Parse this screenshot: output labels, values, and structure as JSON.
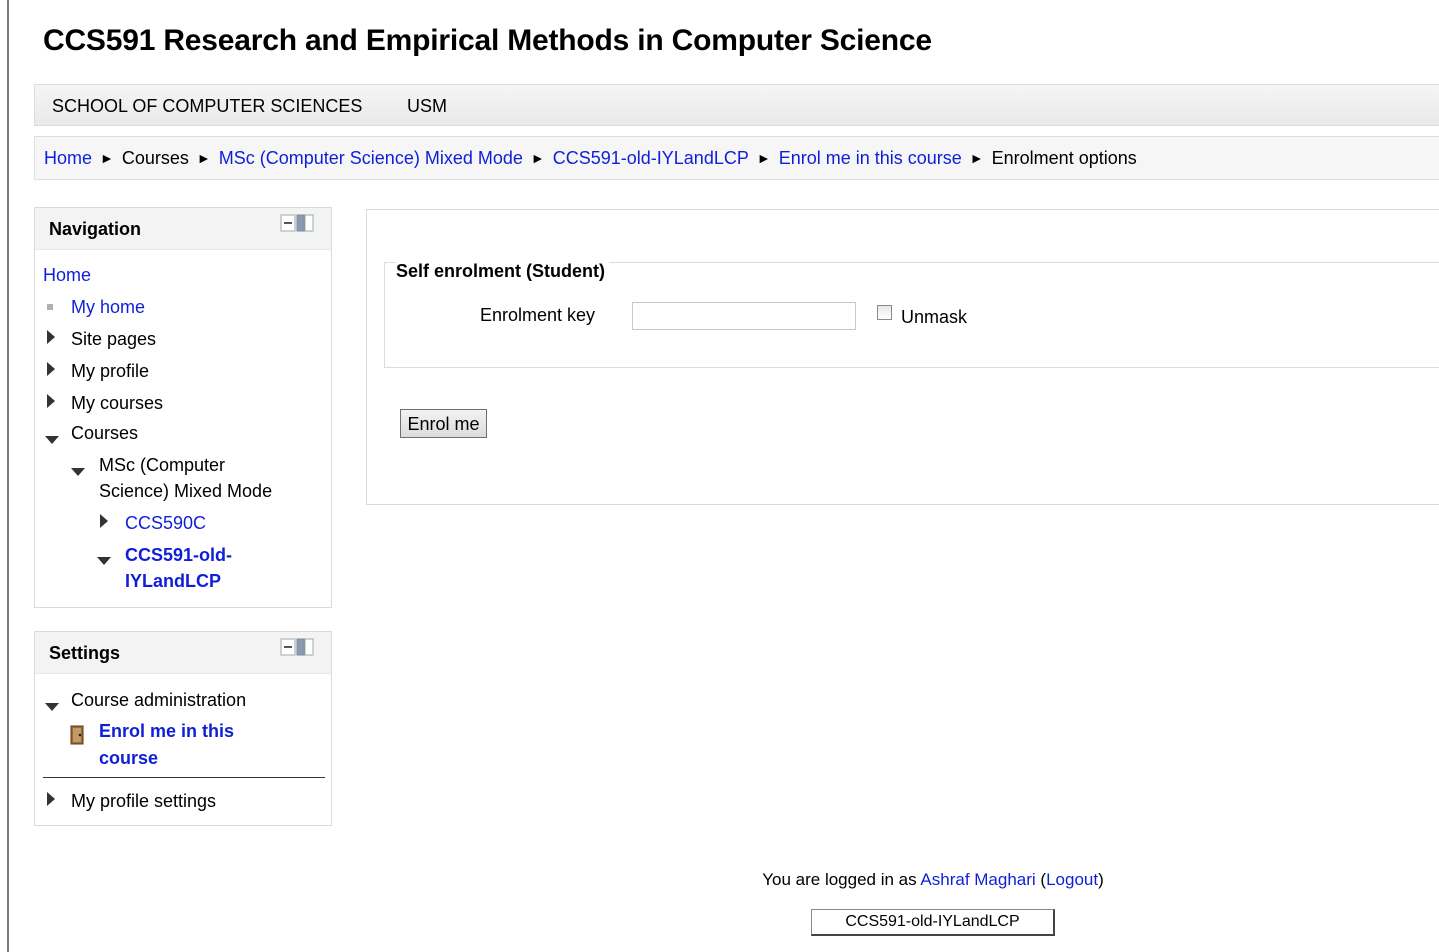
{
  "page": {
    "title": "CCS591 Research and Empirical Methods in Computer Science"
  },
  "custom_menu": {
    "items": [
      "SCHOOL OF COMPUTER SCIENCES",
      "USM"
    ]
  },
  "breadcrumb": {
    "items": [
      {
        "label": "Home",
        "link": true
      },
      {
        "label": "Courses",
        "link": false
      },
      {
        "label": "MSc (Computer Science) Mixed Mode",
        "link": true
      },
      {
        "label": "CCS591-old-IYLandLCP",
        "link": true
      },
      {
        "label": "Enrol me in this course",
        "link": true
      },
      {
        "label": "Enrolment options",
        "link": false
      }
    ],
    "separator": "►"
  },
  "navigation": {
    "title": "Navigation",
    "home": "Home",
    "my_home": "My home",
    "site_pages": "Site pages",
    "my_profile": "My profile",
    "my_courses": "My courses",
    "courses": "Courses",
    "msc_line1": "MSc (Computer",
    "msc_line2": "Science) Mixed Mode",
    "ccs590c": "CCS590C",
    "ccs591_line1": "CCS591-old-",
    "ccs591_line2": "IYLandLCP"
  },
  "settings": {
    "title": "Settings",
    "course_admin": "Course administration",
    "enrol_line1": "Enrol me in this",
    "enrol_line2": "course",
    "my_profile_settings": "My profile settings"
  },
  "main": {
    "legend": "Self enrolment (Student)",
    "enrolment_key_label": "Enrolment key",
    "enrolment_key_value": "",
    "unmask_label": "Unmask",
    "unmask_checked": false,
    "submit_label": "Enrol me"
  },
  "footer": {
    "logged_in_prefix": "You are logged in as ",
    "user_name": "Ashraf Maghari",
    "open_paren": " (",
    "logout": "Logout",
    "close_paren": ")",
    "course_button": "CCS591-old-IYLandLCP"
  },
  "colors": {
    "link": "#0f1fd9",
    "block_header_bg": "#f3f3f3",
    "navbar_bg": "#f6f6f6"
  },
  "icons": {
    "dock": "dock-block-icon",
    "enrol": "door-icon",
    "collapsed": "triangle-right-icon",
    "expanded": "triangle-down-icon"
  }
}
